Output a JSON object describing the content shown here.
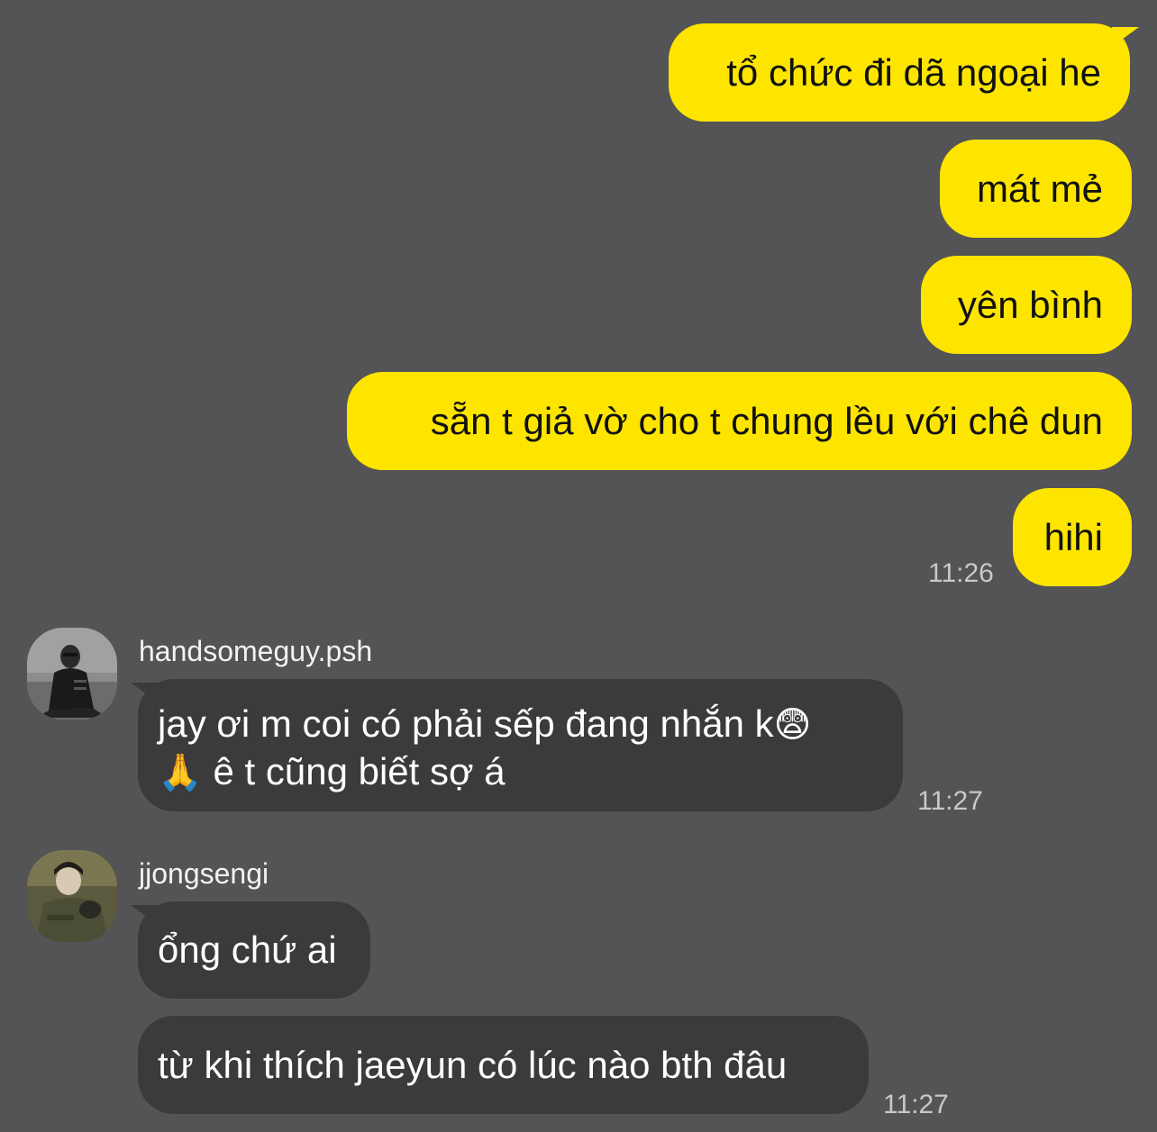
{
  "colors": {
    "background": "#545355",
    "outgoing_bubble": "#FEE500",
    "incoming_bubble": "#3B3A3C",
    "timestamp": "#C9C7CA"
  },
  "outgoing": {
    "messages": [
      "tổ chức đi dã ngoại he",
      "mát mẻ",
      "yên bình",
      "sẵn t giả vờ cho t chung lều với chê dun",
      "hihi"
    ],
    "time": "11:26"
  },
  "incoming_1": {
    "sender": "handsomeguy.psh",
    "avatar_icon": "avatar-icon",
    "line1": "jay ơi m coi có phải sếp đang nhắn k",
    "emoji_fear": "😨",
    "emoji_pray": "🙏",
    "line2": " ê t cũng biết sợ á",
    "time": "11:27"
  },
  "incoming_2": {
    "sender": "jjongsengi",
    "avatar_icon": "avatar-icon",
    "messages": [
      "ổng chứ ai",
      "từ khi thích jaeyun có lúc nào bth đâu"
    ],
    "time": "11:27"
  }
}
